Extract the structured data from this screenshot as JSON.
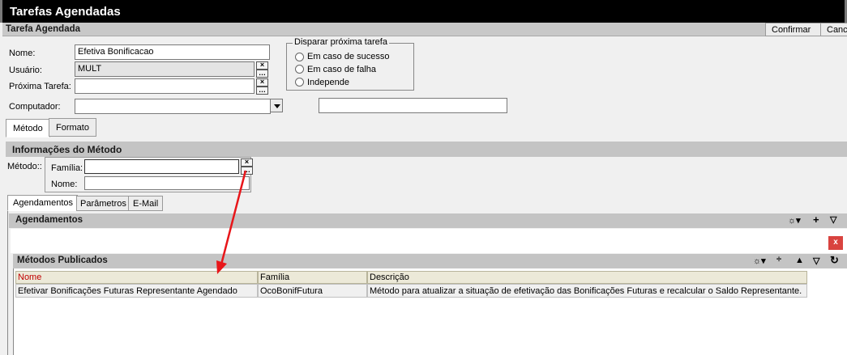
{
  "window": {
    "title": "Tarefas Agendadas"
  },
  "header": {
    "title": "Tarefa Agendada",
    "confirm_label": "Confirmar",
    "cancel_label": "Cancelar"
  },
  "form": {
    "nome_label": "Nome:",
    "nome_value": "Efetiva Bonificacao",
    "usuario_label": "Usuário:",
    "usuario_value": "MULT",
    "proxima_label": "Próxima Tarefa:",
    "proxima_value": "",
    "computador_label": "Computador:",
    "computador_value": "",
    "extra_value": ""
  },
  "disparar": {
    "legend": "Disparar próxima tarefa",
    "options": [
      "Em caso de sucesso",
      "Em caso de falha",
      "Independe"
    ]
  },
  "top_tabs": [
    "Método",
    "Formato"
  ],
  "metodo": {
    "section_title": "Informações do Método",
    "metodo_label": "Método::",
    "familia_label": "Família:",
    "familia_value": "",
    "nome_label": "Nome:",
    "nome_value": ""
  },
  "sub_tabs": [
    "Agendamentos",
    "Parâmetros",
    "E-Mail"
  ],
  "agendamentos": {
    "title": "Agendamentos",
    "close_label": "x"
  },
  "metodos_publicados": {
    "title": "Métodos Publicados",
    "columns": [
      "Nome",
      "Família",
      "Descrição"
    ],
    "rows": [
      [
        "Efetivar Bonificações Futuras Representante Agendado",
        "OcoBonifFutura",
        "Método para atualizar a situação de efetivação das Bonificações Futuras e recalcular o Saldo Representante."
      ]
    ]
  },
  "colors": {
    "annotation_arrow": "#e8161a",
    "header_bg": "#000000",
    "section_bg": "#c4c4c4",
    "close_button": "#d9433f"
  }
}
